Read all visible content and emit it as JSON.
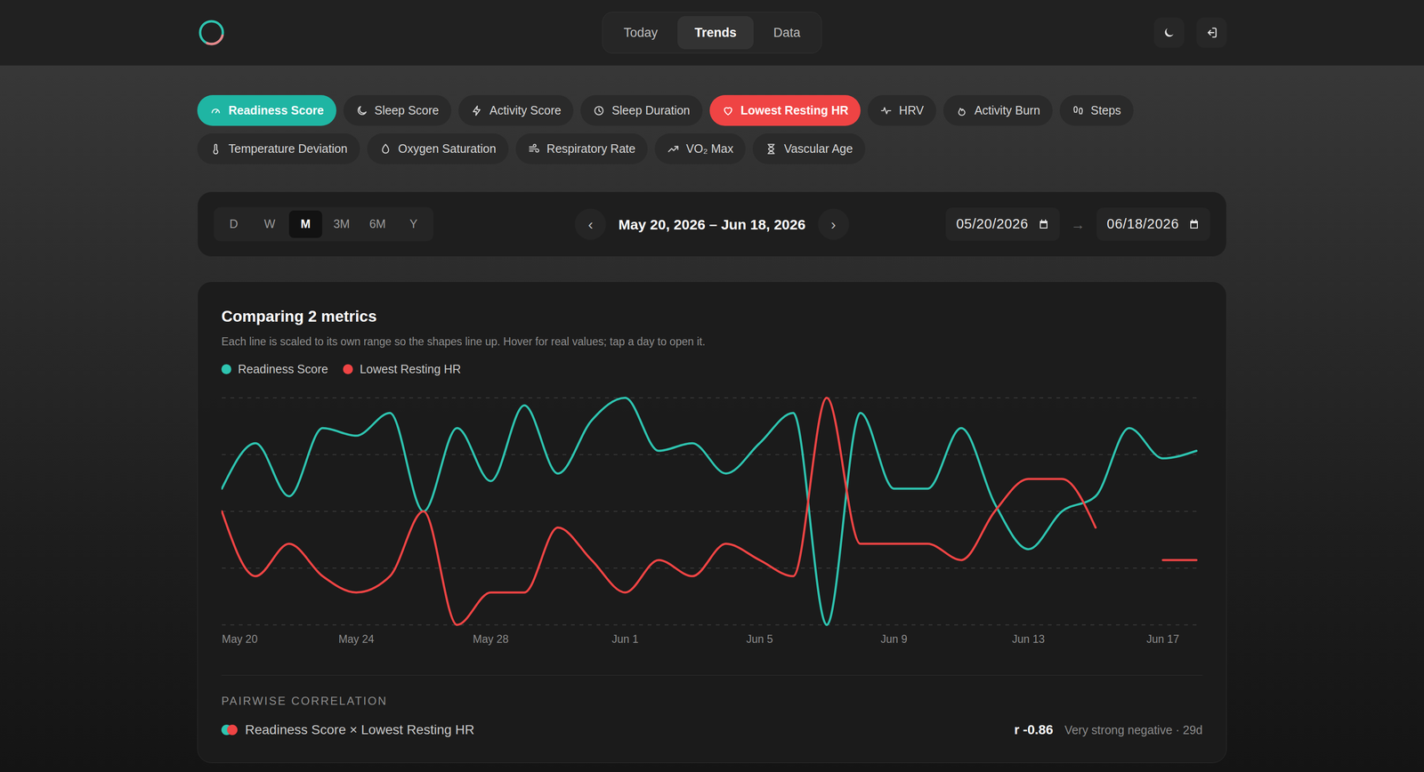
{
  "header": {
    "nav": [
      {
        "label": "Today",
        "selected": false
      },
      {
        "label": "Trends",
        "selected": true
      },
      {
        "label": "Data",
        "selected": false
      }
    ]
  },
  "metrics": [
    {
      "label": "Readiness Score",
      "selected": true,
      "color": "#1fb5a3"
    },
    {
      "label": "Sleep Score",
      "selected": false
    },
    {
      "label": "Activity Score",
      "selected": false
    },
    {
      "label": "Sleep Duration",
      "selected": false
    },
    {
      "label": "Lowest Resting HR",
      "selected": true,
      "color": "#ef4444"
    },
    {
      "label": "HRV",
      "selected": false
    },
    {
      "label": "Activity Burn",
      "selected": false
    },
    {
      "label": "Steps",
      "selected": false
    },
    {
      "label": "Temperature Deviation",
      "selected": false
    },
    {
      "label": "Oxygen Saturation",
      "selected": false
    },
    {
      "label": "Respiratory Rate",
      "selected": false
    },
    {
      "label": "VO₂ Max",
      "selected": false
    },
    {
      "label": "Vascular Age",
      "selected": false
    }
  ],
  "range": {
    "periods": [
      {
        "label": "D",
        "selected": false
      },
      {
        "label": "W",
        "selected": false
      },
      {
        "label": "M",
        "selected": true
      },
      {
        "label": "3M",
        "selected": false
      },
      {
        "label": "6M",
        "selected": false
      },
      {
        "label": "Y",
        "selected": false
      }
    ],
    "prev": "‹",
    "title": "May 20, 2026 – Jun 18, 2026",
    "next": "›",
    "from": "05/20/2026",
    "arrow": "→",
    "to": "06/18/2026"
  },
  "chart": {
    "title": "Comparing 2 metrics",
    "subtitle": "Each line is scaled to its own range so the shapes line up. Hover for real values; tap a day to open it.",
    "x_labels": [
      "May 20",
      "May 24",
      "May 28",
      "Jun 1",
      "Jun 5",
      "Jun 9",
      "Jun 13",
      "Jun 17"
    ],
    "series": [
      {
        "name": "Readiness Score",
        "color": "#2ec4b0",
        "values": [
          80,
          86,
          79,
          88,
          87,
          90,
          77,
          88,
          81,
          91,
          82,
          89,
          92,
          85,
          86,
          82,
          86,
          90,
          62,
          90,
          80,
          80,
          88,
          78,
          72,
          77,
          79,
          88,
          84,
          85
        ]
      },
      {
        "name": "Lowest Resting HR",
        "color": "#ef4444",
        "values": [
          55,
          51,
          53,
          51,
          50,
          51,
          55,
          48,
          50,
          50,
          54,
          52,
          50,
          52,
          51,
          53,
          52,
          51,
          62,
          53,
          53,
          53,
          52,
          55,
          57,
          57,
          54,
          null,
          52,
          52
        ]
      }
    ]
  },
  "correlation": {
    "heading": "PAIRWISE CORRELATION",
    "pairs": [
      {
        "label": "Readiness Score × Lowest Resting HR",
        "colors": [
          "#2ec4b0",
          "#ef4444"
        ],
        "r": "r -0.86",
        "description": "Very strong negative · 29d"
      }
    ]
  }
}
